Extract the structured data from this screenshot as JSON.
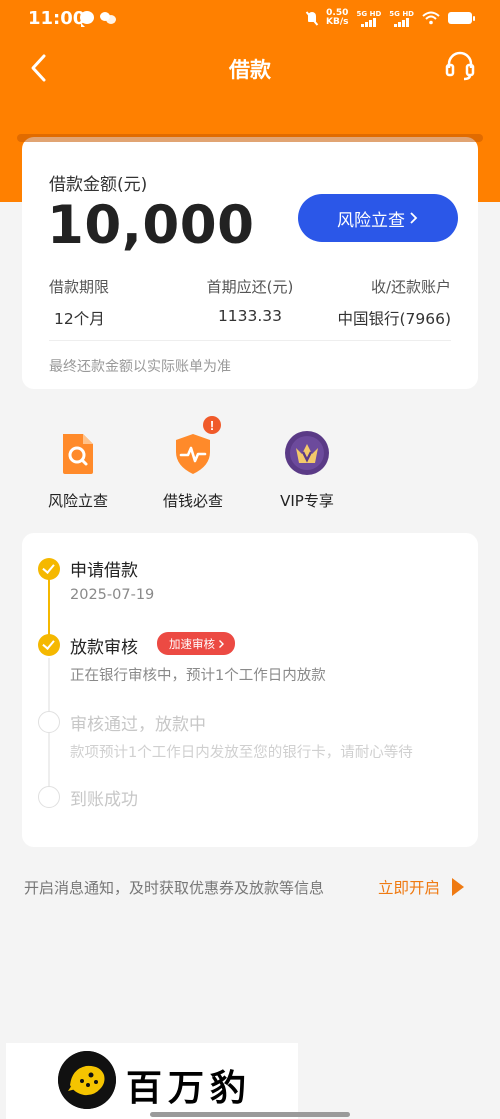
{
  "status_bar": {
    "time": "11:00",
    "net_speed_top": "0.50",
    "net_speed_unit": "KB/s",
    "sim1_label": "5G HD",
    "sim2_label": "5G HD"
  },
  "header": {
    "title": "借款"
  },
  "summary": {
    "amount_label": "借款金额(元)",
    "amount_value": "10,000",
    "risk_button_label": "风险立查",
    "columns": [
      {
        "label": "借款期限",
        "value": "12个月"
      },
      {
        "label": "首期应还(元)",
        "value": "1133.33"
      },
      {
        "label": "收/还款账户",
        "value": "中国银行(7966)"
      }
    ],
    "note": "最终还款金额以实际账单为准"
  },
  "quick_actions": [
    {
      "label": "风险立查",
      "icon": "search-doc-icon"
    },
    {
      "label": "借钱必查",
      "icon": "shield-pulse-icon",
      "alert_badge": "!"
    },
    {
      "label": "VIP专享",
      "icon": "vip-crown-icon"
    }
  ],
  "timeline": {
    "steps": [
      {
        "title": "申请借款",
        "subtitle": "2025-07-19",
        "status": "done"
      },
      {
        "title": "放款审核",
        "subtitle": "正在银行审核中，预计1个工作日内放款",
        "status": "done",
        "badge": "加速审核"
      },
      {
        "title": "审核通过，放款中",
        "subtitle": "款项预计1个工作日内发放至您的银行卡，请耐心等待",
        "status": "pending"
      },
      {
        "title": "到账成功",
        "subtitle": "",
        "status": "pending"
      }
    ]
  },
  "notice": {
    "text": "开启消息通知，及时获取优惠券及放款等信息",
    "link": "立即开启"
  },
  "brand": {
    "name": "百万豹"
  },
  "colors": {
    "primary_orange": "#ff8000",
    "primary_blue": "#2b57e8",
    "timeline_yellow": "#f5b800",
    "badge_red": "#ec4a43",
    "link_orange": "#ef7a12"
  }
}
